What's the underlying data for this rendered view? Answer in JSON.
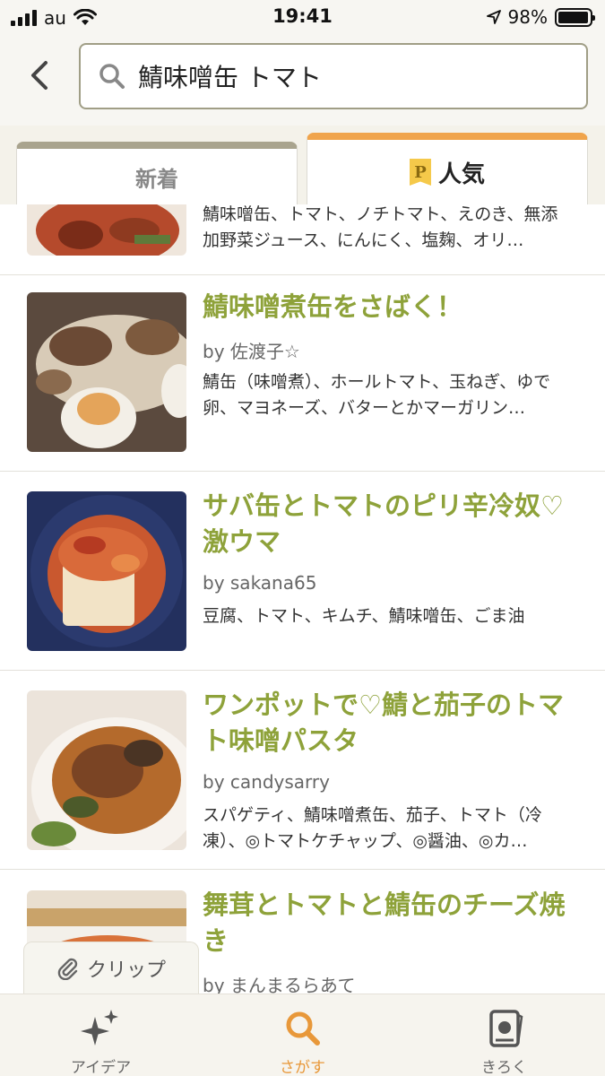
{
  "status_bar": {
    "carrier": "au",
    "time": "19:41",
    "battery": "98%",
    "battery_level": 0.98
  },
  "header": {
    "search_value": "鯖味噌缶 トマト"
  },
  "tabs": [
    {
      "label": "新着",
      "active": false
    },
    {
      "label": "人気",
      "active": true,
      "badge": "P"
    }
  ],
  "recipes": [
    {
      "title": "",
      "author": "",
      "ingredients": "鯖味噌缶、トマト、ノチトマト、えのき、無添加野菜ジュース、にんにく、塩麹、オリ…"
    },
    {
      "title": "鯖味噌煮缶をさばく！",
      "author": "by 佐渡子☆",
      "ingredients": "鯖缶（味噌煮）、ホールトマト、玉ねぎ、ゆで卵、マヨネーズ、バターとかマーガリン…"
    },
    {
      "title": "サバ缶とトマトのピリ辛冷奴♡激ウマ",
      "author": "by sakana65",
      "ingredients": "豆腐、トマト、キムチ、鯖味噌缶、ごま油"
    },
    {
      "title": "ワンポットで♡鯖と茄子のトマト味噌パスタ",
      "author": "by candysarry",
      "ingredients": "スパゲティ、鯖味噌煮缶、茄子、トマト（冷凍）、◎トマトケチャップ、◎醤油、◎カ…"
    },
    {
      "title": "舞茸とトマトと鯖缶のチーズ焼き",
      "author": "by まんまるらあて",
      "ingredients": ""
    }
  ],
  "clip": {
    "label": "クリップ"
  },
  "bottom_nav": [
    {
      "label": "アイデア",
      "icon": "sparkle-icon",
      "active": false
    },
    {
      "label": "さがす",
      "icon": "search-icon",
      "active": true
    },
    {
      "label": "きろく",
      "icon": "record-card-icon",
      "active": false
    }
  ],
  "colors": {
    "title_green": "#8ea23a",
    "accent_orange": "#e8983a",
    "tab_active_border": "#f0a44c",
    "tab_inactive_border": "#a9a48e"
  }
}
